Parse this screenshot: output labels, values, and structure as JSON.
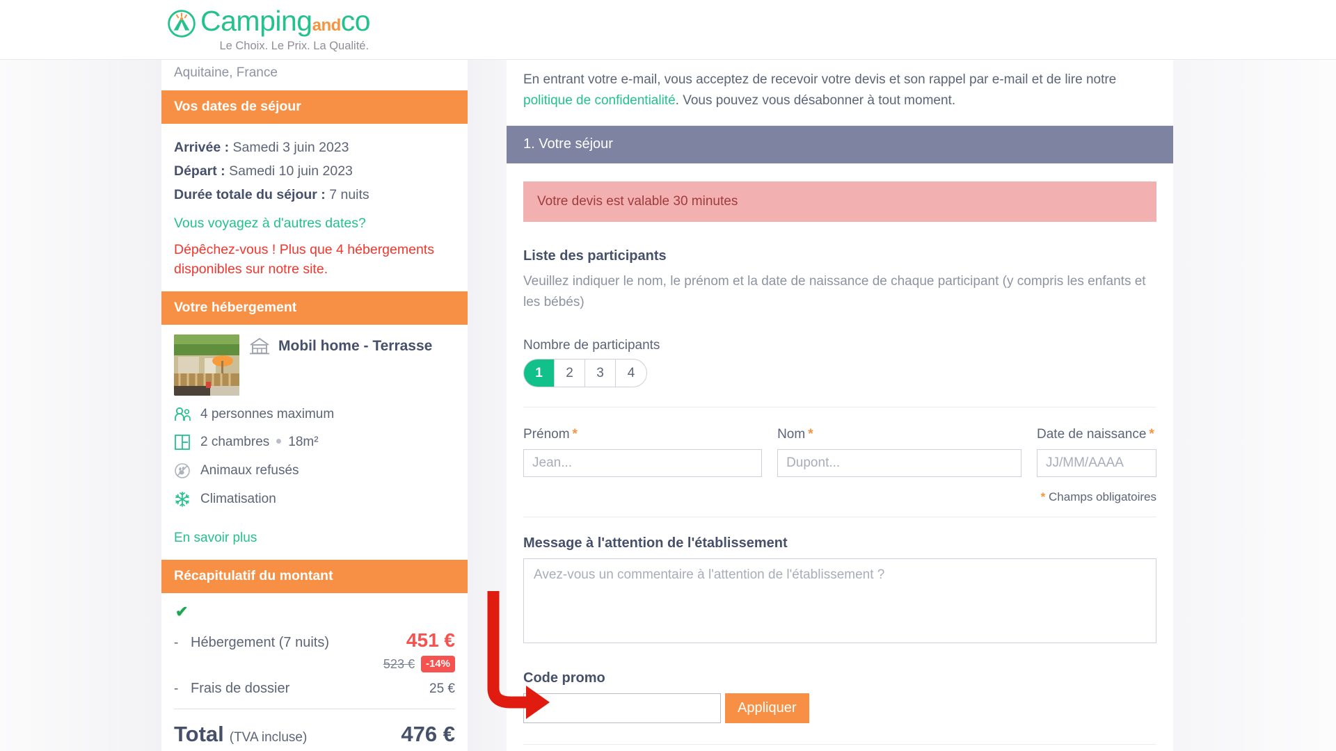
{
  "header": {
    "logo_camping": "Camping",
    "logo_and": "and",
    "logo_co": "co",
    "tagline": "Le Choix. Le Prix. La Qualité."
  },
  "sidebar": {
    "location": "Aquitaine, France",
    "dates_section": {
      "title": "Vos dates de séjour",
      "arrival_label": "Arrivée :",
      "arrival_value": "Samedi 3 juin 2023",
      "departure_label": "Départ :",
      "departure_value": "Samedi 10 juin 2023",
      "duration_label": "Durée totale du séjour :",
      "duration_value": "7 nuits",
      "other_dates_link": "Vous voyagez à d'autres dates?",
      "urgency": "Dépêchez-vous ! Plus que 4 hébergements disponibles sur notre site."
    },
    "accommodation_section": {
      "title": "Votre hébergement",
      "name": "Mobil home - Terrasse",
      "amenities": [
        {
          "icon": "people-icon",
          "text": "4 personnes maximum"
        },
        {
          "icon": "floorplan-icon",
          "text": "2 chambres",
          "text2": "18m²"
        },
        {
          "icon": "no-pets-icon",
          "text": "Animaux refusés"
        },
        {
          "icon": "snowflake-icon",
          "text": "Climatisation"
        }
      ],
      "more_link": "En savoir plus"
    },
    "price_section": {
      "title": "Récapitulatif du montant",
      "check_mark": "✔",
      "rows": [
        {
          "dash": "-",
          "label": "Hébergement (7 nuits)",
          "amount": "451 €",
          "old_amount": "523 €",
          "discount": "-14%"
        },
        {
          "dash": "-",
          "label": "Frais de dossier",
          "amount": "25 €"
        }
      ],
      "total_label": "Total",
      "total_sub": "(TVA incluse)",
      "total_amount": "476 €"
    }
  },
  "main": {
    "privacy_text_1": "En entrant votre e-mail, vous acceptez de recevoir votre devis et son rappel par e-mail et de lire notre ",
    "privacy_link": "politique de confidentialité",
    "privacy_text_2": ". Vous pouvez vous désabonner à tout moment.",
    "section_title": "1. Votre séjour",
    "alert": "Votre devis est valable 30 minutes",
    "participants_title": "Liste des participants",
    "participants_help": "Veuillez indiquer le nom, le prénom et la date de naissance de chaque participant (y compris les enfants et les bébés)",
    "participants_count_label": "Nombre de participants",
    "participant_options": [
      "1",
      "2",
      "3",
      "4"
    ],
    "participant_selected": "1",
    "form": {
      "firstname_label": "Prénom",
      "firstname_placeholder": "Jean...",
      "firstname_value": "",
      "lastname_label": "Nom",
      "lastname_placeholder": "Dupont...",
      "lastname_value": "",
      "birthdate_label": "Date de naissance",
      "birthdate_placeholder": "JJ/MM/AAAA",
      "birthdate_value": "",
      "required_star": "*",
      "required_note": "Champs obligatoires"
    },
    "message_label": "Message à l'attention de l'établissement",
    "message_placeholder": "Avez-vous un commentaire à l'attention de l'établissement ?",
    "message_value": "",
    "promo_label": "Code promo",
    "promo_placeholder": "",
    "promo_value": "",
    "promo_button": "Appliquer"
  },
  "annotation": {
    "arrow_color": "#e01b0f",
    "arrow_target": "promo-code-input"
  }
}
